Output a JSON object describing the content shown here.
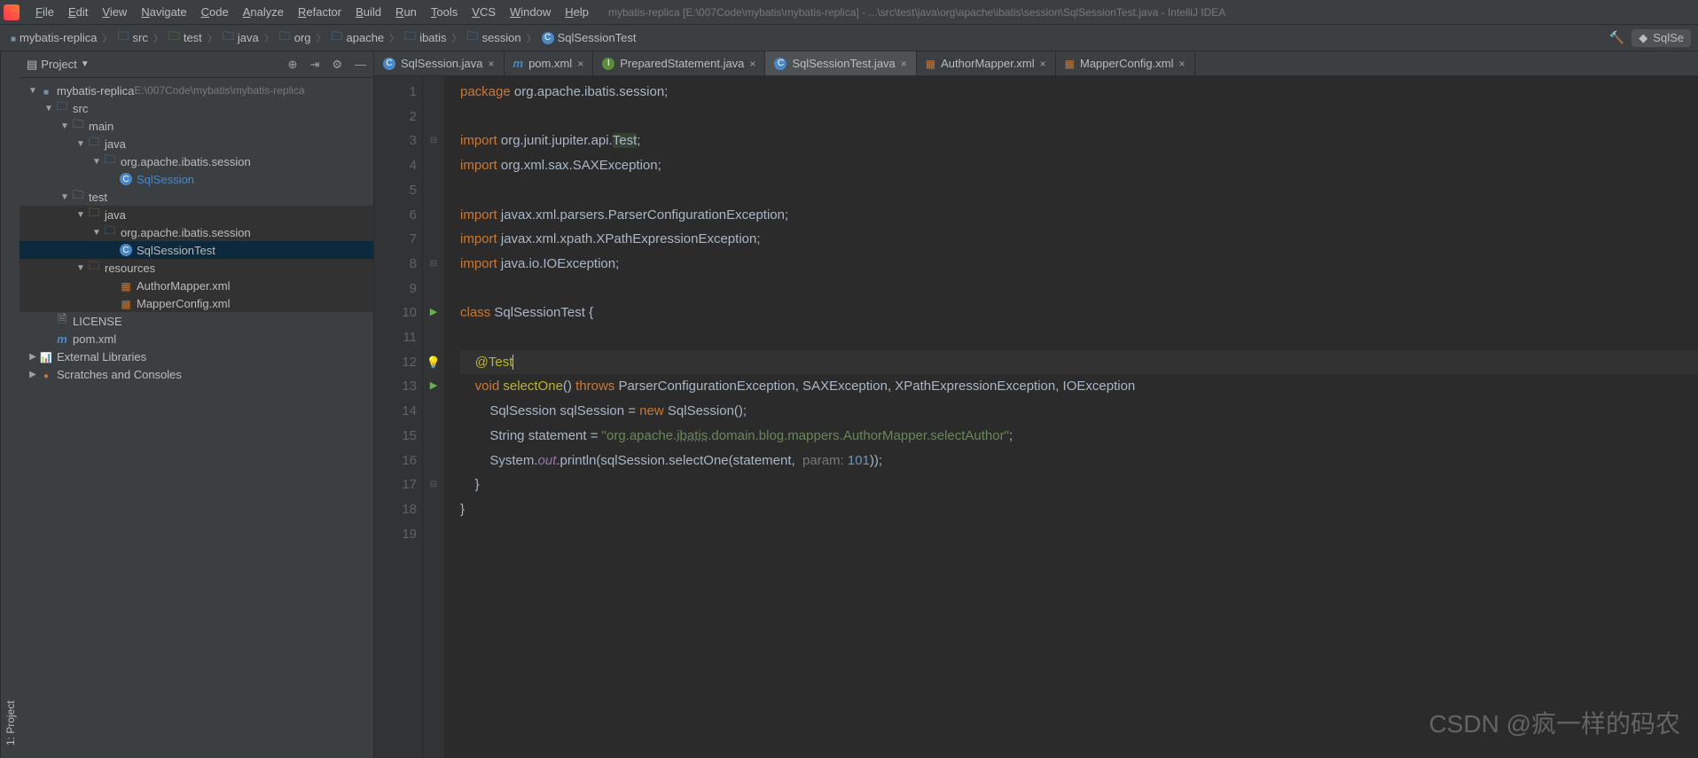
{
  "app": {
    "title_suffix": "mybatis-replica [E:\\007Code\\mybatis\\mybatis-replica] - ...\\src\\test\\java\\org\\apache\\ibatis\\session\\SqlSessionTest.java - IntelliJ IDEA"
  },
  "menu": [
    "File",
    "Edit",
    "View",
    "Navigate",
    "Code",
    "Analyze",
    "Refactor",
    "Build",
    "Run",
    "Tools",
    "VCS",
    "Window",
    "Help"
  ],
  "breadcrumbs": [
    {
      "icon": "module",
      "label": "mybatis-replica"
    },
    {
      "icon": "folder-blue",
      "label": "src"
    },
    {
      "icon": "folder-green",
      "label": "test"
    },
    {
      "icon": "folder-blue",
      "label": "java"
    },
    {
      "icon": "folder-blue",
      "label": "org"
    },
    {
      "icon": "folder-blue",
      "label": "apache"
    },
    {
      "icon": "folder-blue",
      "label": "ibatis"
    },
    {
      "icon": "folder-blue",
      "label": "session"
    },
    {
      "icon": "java-c",
      "label": "SqlSessionTest"
    }
  ],
  "toolbar_right": {
    "run_config": "SqlSe"
  },
  "sidebar": {
    "project_tab": "1: Project"
  },
  "project_panel": {
    "title": "Project",
    "icons": {
      "target": "⊕",
      "collapse": "⇥",
      "gear": "⚙",
      "hide": "—"
    }
  },
  "tree": [
    {
      "d": 0,
      "arrow": "▼",
      "icon": "module",
      "label": "mybatis-replica",
      "sub": "  E:\\007Code\\mybatis\\mybatis-replica"
    },
    {
      "d": 1,
      "arrow": "▼",
      "icon": "folder-blue",
      "label": "src"
    },
    {
      "d": 2,
      "arrow": "▼",
      "icon": "folder",
      "label": "main"
    },
    {
      "d": 3,
      "arrow": "▼",
      "icon": "folder-blue",
      "label": "java"
    },
    {
      "d": 4,
      "arrow": "▼",
      "icon": "folder-blue",
      "label": "org.apache.ibatis.session"
    },
    {
      "d": 5,
      "arrow": "",
      "icon": "java-c",
      "label": "SqlSession",
      "labelColor": "#4a88c7"
    },
    {
      "d": 2,
      "arrow": "▼",
      "icon": "folder",
      "label": "test"
    },
    {
      "d": 3,
      "arrow": "▼",
      "icon": "folder-green",
      "label": "java",
      "hl": true
    },
    {
      "d": 4,
      "arrow": "▼",
      "icon": "folder-blue",
      "label": "org.apache.ibatis.session",
      "hl": true
    },
    {
      "d": 5,
      "arrow": "",
      "icon": "java-c",
      "label": "SqlSessionTest",
      "sel": true
    },
    {
      "d": 3,
      "arrow": "▼",
      "icon": "folder-red",
      "label": "resources",
      "hl": true
    },
    {
      "d": 5,
      "arrow": "",
      "icon": "xml",
      "label": "AuthorMapper.xml",
      "hl": true
    },
    {
      "d": 5,
      "arrow": "",
      "icon": "xml",
      "label": "MapperConfig.xml",
      "hl": true
    },
    {
      "d": 1,
      "arrow": "",
      "icon": "file",
      "label": "LICENSE"
    },
    {
      "d": 1,
      "arrow": "",
      "icon": "m",
      "label": "pom.xml"
    },
    {
      "d": 0,
      "arrow": "▶",
      "icon": "lib",
      "label": "External Libraries"
    },
    {
      "d": 0,
      "arrow": "▶",
      "icon": "scratch",
      "label": "Scratches and Consoles"
    }
  ],
  "tabs": [
    {
      "icon": "java-c",
      "label": "SqlSession.java"
    },
    {
      "icon": "m",
      "label": "pom.xml"
    },
    {
      "icon": "interface",
      "label": "PreparedStatement.java"
    },
    {
      "icon": "java-c",
      "label": "SqlSessionTest.java",
      "active": true
    },
    {
      "icon": "xml",
      "label": "AuthorMapper.xml"
    },
    {
      "icon": "xml",
      "label": "MapperConfig.xml"
    }
  ],
  "code": {
    "lines": [
      {
        "n": 1,
        "html": "<span class='kw'>package</span> org.apache.ibatis.session;"
      },
      {
        "n": 2,
        "html": ""
      },
      {
        "n": 3,
        "html": "<span class='kw'>import</span> org.junit.jupiter.api.<span class='hl-test'>Test</span>;",
        "fold": "⊟"
      },
      {
        "n": 4,
        "html": "<span class='kw'>import</span> org.xml.sax.SAXException;"
      },
      {
        "n": 5,
        "html": ""
      },
      {
        "n": 6,
        "html": "<span class='kw'>import</span> javax.xml.parsers.ParserConfigurationException;"
      },
      {
        "n": 7,
        "html": "<span class='kw'>import</span> javax.xml.xpath.XPathExpressionException;"
      },
      {
        "n": 8,
        "html": "<span class='kw'>import</span> java.io.IOException;",
        "fold": "⊟"
      },
      {
        "n": 9,
        "html": ""
      },
      {
        "n": 10,
        "html": "<span class='kw'>class</span> SqlSessionTest {",
        "gicon": "run"
      },
      {
        "n": 11,
        "html": ""
      },
      {
        "n": 12,
        "html": "    <span class='ann'>@Test</span><span class='caret'></span>",
        "cursor": true,
        "gicon": "bulb"
      },
      {
        "n": 13,
        "html": "    <span class='kw'>void</span> <span class='ann'>selectOne</span>() <span class='kw'>throws</span> ParserConfigurationException, SAXException, XPathExpressionException, IOException",
        "gicon": "run",
        "fold": "⊟"
      },
      {
        "n": 14,
        "html": "        SqlSession sqlSession = <span class='kw'>new</span> SqlSession();"
      },
      {
        "n": 15,
        "html": "        String statement = <span class='str'>\"org.apache.<span class='u'>ibatis</span>.domain.blog.mappers.AuthorMapper.selectAuthor\"</span>;"
      },
      {
        "n": 16,
        "html": "        System.<span class='it'>out</span>.println(sqlSession.selectOne(statement,  <span class='hint'>param:</span> <span class='num'>101</span>));"
      },
      {
        "n": 17,
        "html": "    }",
        "fold": "⊟"
      },
      {
        "n": 18,
        "html": "}"
      },
      {
        "n": 19,
        "html": ""
      }
    ]
  },
  "watermark": "CSDN @疯一样的码农"
}
